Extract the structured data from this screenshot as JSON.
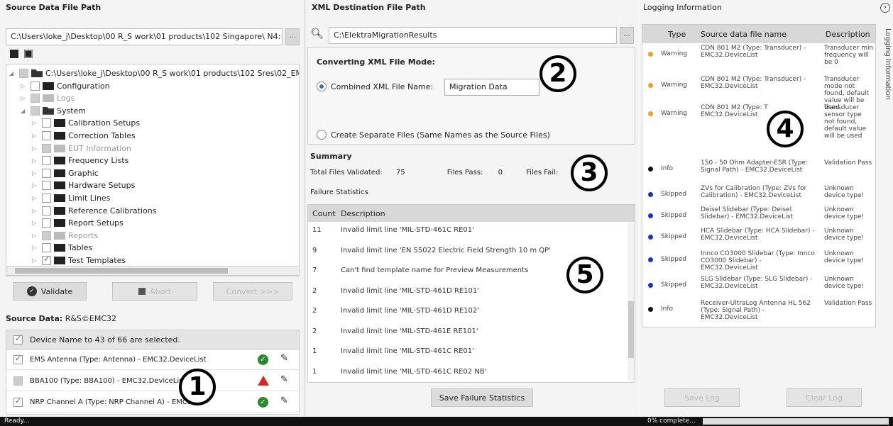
{
  "left": {
    "title": "Source Data File Path",
    "path": "C:\\Users\\loke_j\\Desktop\\00 R_S work\\01 products\\102 Singapore\\ N4:",
    "browse": "...",
    "tree": [
      {
        "label": "C:\\Users\\loke_j\\Desktop\\00 R_S work\\01 products\\102 Sres\\02_EM",
        "state": "gray",
        "open": true
      },
      {
        "label": "Configuration",
        "state": "empty"
      },
      {
        "label": "Logs",
        "state": "gray",
        "dim": true
      },
      {
        "label": "System",
        "state": "gray",
        "open": true
      },
      {
        "label": "Calibration Setups",
        "state": "empty"
      },
      {
        "label": "Correction Tables",
        "state": "empty"
      },
      {
        "label": "EUT Information",
        "state": "gray",
        "dim": true
      },
      {
        "label": "Frequency Lists",
        "state": "empty"
      },
      {
        "label": "Graphic",
        "state": "empty"
      },
      {
        "label": "Hardware Setups",
        "state": "empty"
      },
      {
        "label": "Limit Lines",
        "state": "empty"
      },
      {
        "label": "Reference Calibrations",
        "state": "empty"
      },
      {
        "label": "Report Setups",
        "state": "empty"
      },
      {
        "label": "Reports",
        "state": "gray",
        "dim": true
      },
      {
        "label": "Tables",
        "state": "empty"
      },
      {
        "label": "Test Templates",
        "state": "chk"
      }
    ],
    "validate": "Validate",
    "abort": "Abort",
    "convert": "Convert >>>",
    "source_label": "Source Data:",
    "source_value": "R&S©EMC32",
    "select_header": "Device Name to 43 of 66 are selected.",
    "devices": [
      {
        "name": "EMS Antenna (Type: Antenna) - EMC32.DeviceList",
        "status": "ok",
        "checked": true
      },
      {
        "name": "BBA100 (Type: BBA100) - EMC32.DeviceList",
        "status": "warn",
        "checked": false
      },
      {
        "name": "NRP Channel A (Type: NRP Channel A) - EMC32",
        "status": "ok",
        "checked": true
      }
    ]
  },
  "mid": {
    "title": "XML Destination File Path",
    "path": "C:\\ElektraMigrationResults",
    "browse": "...",
    "mode_title": "Converting XML File Mode:",
    "opt1": "Combined XML File Name:",
    "opt1_value": "Migration Data",
    "opt2": "Create Separate Files (Same Names as the Source Files)",
    "summary": "Summary",
    "validated_label": "Total Files Validated:",
    "validated": "75",
    "pass_label": "Files Pass:",
    "pass": "0",
    "fail_label": "Files Fail:",
    "failure_title": "Failure Statistics",
    "col_count": "Count",
    "col_desc": "Description",
    "rows": [
      {
        "count": "11",
        "desc": "Invalid limit line 'MIL-STD-461C RE01'"
      },
      {
        "count": "9",
        "desc": "Invalid limit line 'EN 55022 Electric Field Strength 10 m QP'"
      },
      {
        "count": "7",
        "desc": "Can't find template name for Preview Measurements"
      },
      {
        "count": "2",
        "desc": "Invalid limit line 'MIL-STD-461D RE101'"
      },
      {
        "count": "2",
        "desc": "Invalid limit line 'MIL-STD-461D RE102'"
      },
      {
        "count": "2",
        "desc": "Invalid limit line 'MIL-STD-461E RE101'"
      },
      {
        "count": "1",
        "desc": "Invalid limit line 'MIL-STD-461C RE01'"
      },
      {
        "count": "1",
        "desc": "Invalid limit line 'MIL-STD-461C RE02 NB'"
      }
    ],
    "save_btn": "Save Failure Statistics"
  },
  "right": {
    "title": "Logging Information",
    "vtab": "Logging Information",
    "col_type": "Type",
    "col_source": "Source data file name",
    "col_desc": "Description",
    "entries": [
      {
        "type": "Warning",
        "color": "#f0a020",
        "source": "CDN 801 M2 (Type: Transducer) - EMC32.DeviceList",
        "desc": "Transducer min frequency will be 0"
      },
      {
        "type": "Warning",
        "color": "#f0a020",
        "source": "CDN 801 M2 (Type: Transducer) - EMC32.DeviceList",
        "desc": "Transducer mode not found, default value will be used"
      },
      {
        "type": "Warning",
        "color": "#f0a020",
        "source": "CDN 801 M2 (Type: T EMC32.DeviceList",
        "desc": "Transducer sensor type not found, default value will be used"
      },
      {
        "type": "Info",
        "color": "#111111",
        "source": "150 - 50 Ohm Adapter-ESR (Type: Signal Path) - EMC32.DeviceList",
        "desc": "Validation Pass"
      },
      {
        "type": "Skipped",
        "color": "#1a2fd0",
        "source": "ZVs for Calibration (Type: ZVs for Calibration) - EMC32.DeviceList",
        "desc": "Unknown device type!"
      },
      {
        "type": "Skipped",
        "color": "#1a2fd0",
        "source": "Deisel Slidebar (Type: Deisel Slidebar) - EMC32.DeviceList",
        "desc": "Unknown device type!"
      },
      {
        "type": "Skipped",
        "color": "#1a2fd0",
        "source": "HCA Slidebar (Type: HCA Slidebar) - EMC32.DeviceList",
        "desc": "Unknown device type!"
      },
      {
        "type": "Skipped",
        "color": "#1a2fd0",
        "source": "Innco CO3000 Slidebar (Type: Innco CO3000 Slidebar) - EMC32.DeviceList",
        "desc": "Unknown device type!"
      },
      {
        "type": "Skipped",
        "color": "#1a2fd0",
        "source": "SLG Slidebar (Type: SLG Slidebar) - EMC32.DeviceList",
        "desc": "Unknown device type!"
      },
      {
        "type": "Info",
        "color": "#111111",
        "source": "Receiver-UltraLog Antenna HL 562 (Type: Signal Path) - EMC32.DeviceList",
        "desc": "Validation Pass"
      }
    ],
    "save_log": "Save Log",
    "clear_log": "Clear Log"
  },
  "callouts": [
    "1",
    "2",
    "3",
    "4",
    "5"
  ],
  "status": {
    "left": "Ready...",
    "right": "0% complete...",
    "progress": 0
  }
}
